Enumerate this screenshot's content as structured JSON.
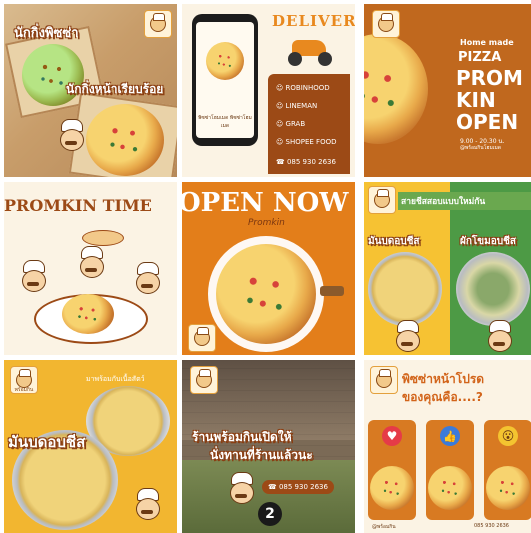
{
  "colors": {
    "orange": "#e8891f",
    "brown": "#9c4a16",
    "cream": "#fbf3e4",
    "yellow": "#f6c233",
    "green": "#4d9a45"
  },
  "tile1": {
    "title": "นักกิ่งพิซซ่า",
    "subtitle": "นักกิ่งหน้าเรียบร้อย"
  },
  "tile2": {
    "heading": "DELIVERY",
    "services": [
      "ROBINHOOD",
      "LINEMAN",
      "GRAB",
      "SHOPEE FOOD"
    ],
    "phone": "085 930 2636",
    "phone_caption": "พิซซ่าโฮมเมด พิซซ่าโฮมเมด"
  },
  "tile3": {
    "small": "Home made",
    "pizza": "PIZZA",
    "prom": "PROM",
    "kin": "KIN",
    "open": "OPEN",
    "hours": "9.00 - 20.30 น.",
    "handle": "@พร้อมกินโฮมเมด"
  },
  "tile4": {
    "title": "PROMKIN TIME"
  },
  "tile5": {
    "title": "OPEN NOW",
    "script": "Promkin"
  },
  "tile6": {
    "top": "สายชีสสอบแบบใหม่กัน",
    "left_label": "มันบดอบชีส",
    "right_label": "ผักโขมอบชีส"
  },
  "tile7": {
    "title": "มันบดอบชีส",
    "caption": "มาพร้อมกับเนื้อสัตว์",
    "logo_text": "พร้อมกิน"
  },
  "tile8": {
    "text1": "ร้านพร้อมกินเปิดให้",
    "text2": "นั่งทานที่ร้านแล้วนะ",
    "phone": "085 930 2636",
    "number": "2"
  },
  "tile9": {
    "title1": "พิซซ่าหน้าโปรด",
    "title2": "ของคุณคือ....?",
    "footer_left": "@พร้อมกิน",
    "footer_right": "085 930 2636"
  },
  "logo_label": "พร้อมกิน"
}
